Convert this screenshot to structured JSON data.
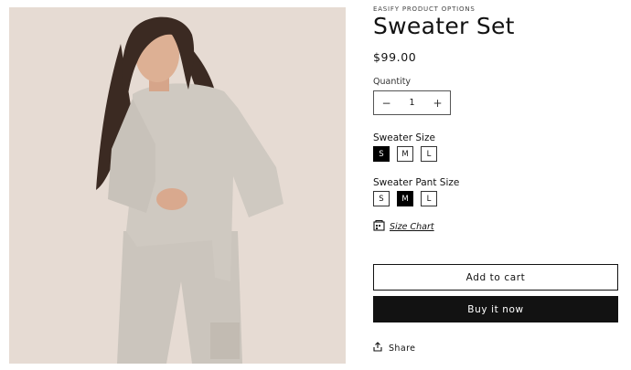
{
  "product": {
    "vendor": "EASIFY PRODUCT OPTIONS",
    "title": "Sweater Set",
    "price": "$99.00",
    "image_alt": "Model wearing a grey knit sweater set"
  },
  "quantity": {
    "label": "Quantity",
    "value": "1",
    "decrease": "−",
    "increase": "+"
  },
  "sweater_size": {
    "label": "Sweater Size",
    "options": [
      "S",
      "M",
      "L"
    ],
    "selected": "S"
  },
  "pant_size": {
    "label": "Sweater Pant Size",
    "options": [
      "S",
      "M",
      "L"
    ],
    "selected": "M"
  },
  "size_chart": {
    "label": "Size Chart",
    "icon": "size-chart-icon"
  },
  "actions": {
    "add_to_cart": "Add to cart",
    "buy_now": "Buy it now"
  },
  "share": {
    "label": "Share",
    "icon": "share-icon"
  },
  "colors": {
    "photo_bg": "#e6dbd3",
    "primary": "#121212",
    "sweater": "#cfc9c1"
  }
}
